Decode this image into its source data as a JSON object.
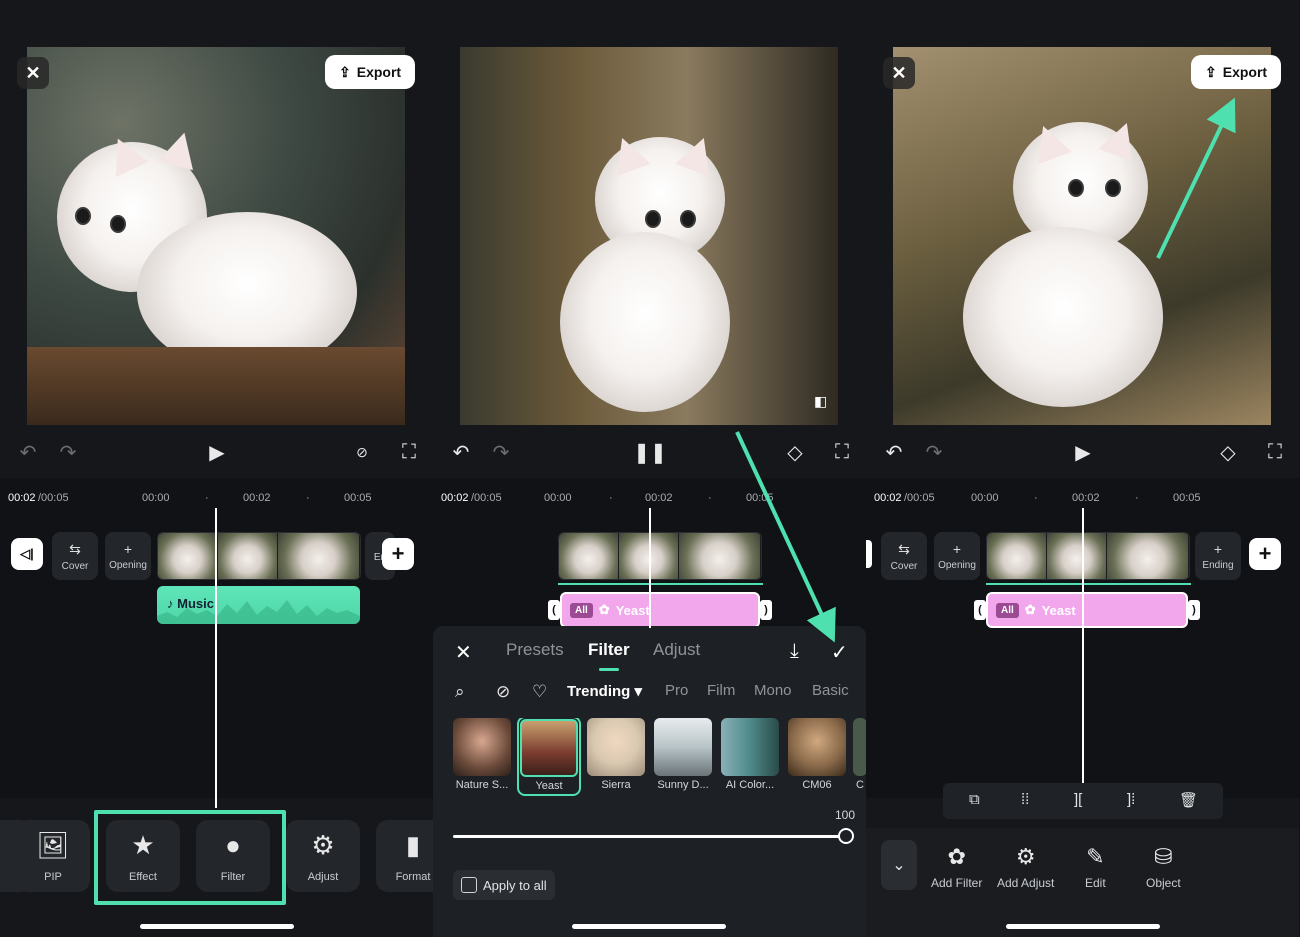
{
  "top": {
    "close_label": "✕",
    "export_label": "Export"
  },
  "timeline": {
    "current": "00:02",
    "total": "/00:05",
    "ticks": [
      "00:00",
      "00:02",
      "00:05"
    ]
  },
  "panel1": {
    "track_buttons": [
      {
        "label": "Cover",
        "icon": "swap-icon"
      },
      {
        "label": "Opening",
        "icon": "plus-icon"
      },
      {
        "label": "En",
        "icon": "plus-icon"
      }
    ],
    "music_label": "Music",
    "tools": [
      {
        "label": "PIP",
        "icon": "image-icon"
      },
      {
        "label": "Effect",
        "icon": "star-icon"
      },
      {
        "label": "Filter",
        "icon": "filter-icon"
      },
      {
        "label": "Adjust",
        "icon": "sliders-icon"
      },
      {
        "label": "Format",
        "icon": "format-icon"
      }
    ]
  },
  "panel2": {
    "filter_track": {
      "all_label": "All",
      "name": "Yeast"
    },
    "tabs": [
      "Presets",
      "Filter",
      "Adjust"
    ],
    "active_tab": "Filter",
    "categories": [
      "Trending",
      "Pro",
      "Film",
      "Mono",
      "Basic"
    ],
    "active_category": "Trending",
    "filters": [
      {
        "label": "Nature S...",
        "color": "#6b4a3a"
      },
      {
        "label": "Yeast",
        "color": "#7a3b2e",
        "selected": true
      },
      {
        "label": "Sierra",
        "color": "#d9c8b0"
      },
      {
        "label": "Sunny D...",
        "color": "#b8c4c8"
      },
      {
        "label": "AI Color...",
        "color": "#4f8a8a"
      },
      {
        "label": "CM06",
        "color": "#8a6a4a"
      },
      {
        "label": "C",
        "color": "#4a5a4a"
      }
    ],
    "intensity": "100",
    "apply_label": "Apply to all"
  },
  "panel3": {
    "track_buttons": [
      {
        "label": "Cover",
        "icon": "swap-icon"
      },
      {
        "label": "Opening",
        "icon": "plus-icon"
      },
      {
        "label": "Ending",
        "icon": "plus-icon"
      }
    ],
    "filter_track": {
      "all_label": "All",
      "name": "Yeast"
    },
    "tools": [
      {
        "label": "Add Filter",
        "icon": "filter-add-icon"
      },
      {
        "label": "Add Adjust",
        "icon": "sliders-icon"
      },
      {
        "label": "Edit",
        "icon": "pencil-icon"
      },
      {
        "label": "Object",
        "icon": "object-icon"
      }
    ]
  },
  "colors": {
    "accent": "#4fe0b0",
    "filter_track": "#f2a6ec",
    "music_track": "#5fe6b8"
  }
}
